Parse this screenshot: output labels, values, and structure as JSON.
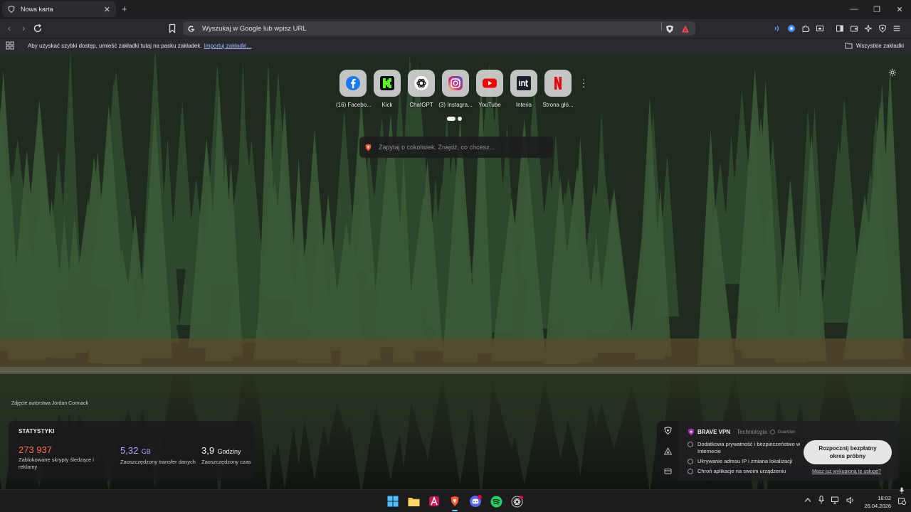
{
  "tab": {
    "title": "Nowa karta",
    "close": "✕",
    "new_tab": "+"
  },
  "window_controls": {
    "minimize": "—",
    "maximize": "❐",
    "close": "✕"
  },
  "toolbar": {
    "back": "‹",
    "forward": "›",
    "address_placeholder": "Wyszukaj w Google lub wpisz URL"
  },
  "bookmarks_bar": {
    "message": "Aby uzyskać szybki dostęp, umieść zakładki tutaj na pasku zakładek.",
    "import_link": "Importuj zakładki...",
    "all_bookmarks": "Wszystkie zakładki"
  },
  "top_sites": [
    {
      "label": "(16) Facebo...",
      "icon": "facebook-icon"
    },
    {
      "label": "Kick",
      "icon": "kick-icon"
    },
    {
      "label": "ChatGPT",
      "icon": "chatgpt-icon"
    },
    {
      "label": "(3) Instagra...",
      "icon": "instagram-icon"
    },
    {
      "label": "YouTube",
      "icon": "youtube-icon"
    },
    {
      "label": "Interia",
      "icon": "interia-icon"
    },
    {
      "label": "Strona głó...",
      "icon": "netflix-icon"
    }
  ],
  "search": {
    "placeholder": "Zapytaj o cokolwiek. Znajdź, co chcesz..."
  },
  "photo_credit": "Zdjęcie autorstwa Jordan Cormack",
  "stats": {
    "title": "STATYSTYKI",
    "trackers": {
      "value": "273 937",
      "desc": "Zablokowane skrypty śledzące i reklamy"
    },
    "bandwidth": {
      "value": "5,32",
      "unit": "GB",
      "desc": "Zaoszczędzony transfer danych"
    },
    "time": {
      "value": "3,9",
      "unit": "Godziny",
      "desc": "Zaoszczędzony czas"
    }
  },
  "vpn": {
    "title": "BRAVE VPN",
    "tech": "Technologia",
    "guardian": "Guardian",
    "features": [
      "Dodatkowa prywatność i bezpieczeństwo w Internecie",
      "Ukrywanie adresu IP i zmiana lokalizacji",
      "Chroń aplikacje na swoim urządzeniu"
    ],
    "cta": "Rozpocznij bezpłatny okres próbny",
    "link": "Masz już wykupioną tę usługę?"
  },
  "taskbar": {
    "time": "18:02",
    "date": "26.04.2026",
    "discord_badge": "9+"
  },
  "colors": {
    "stat_red": "#ff6b4a",
    "stat_purple": "#b7a6ff",
    "accent": "#60cdff"
  }
}
